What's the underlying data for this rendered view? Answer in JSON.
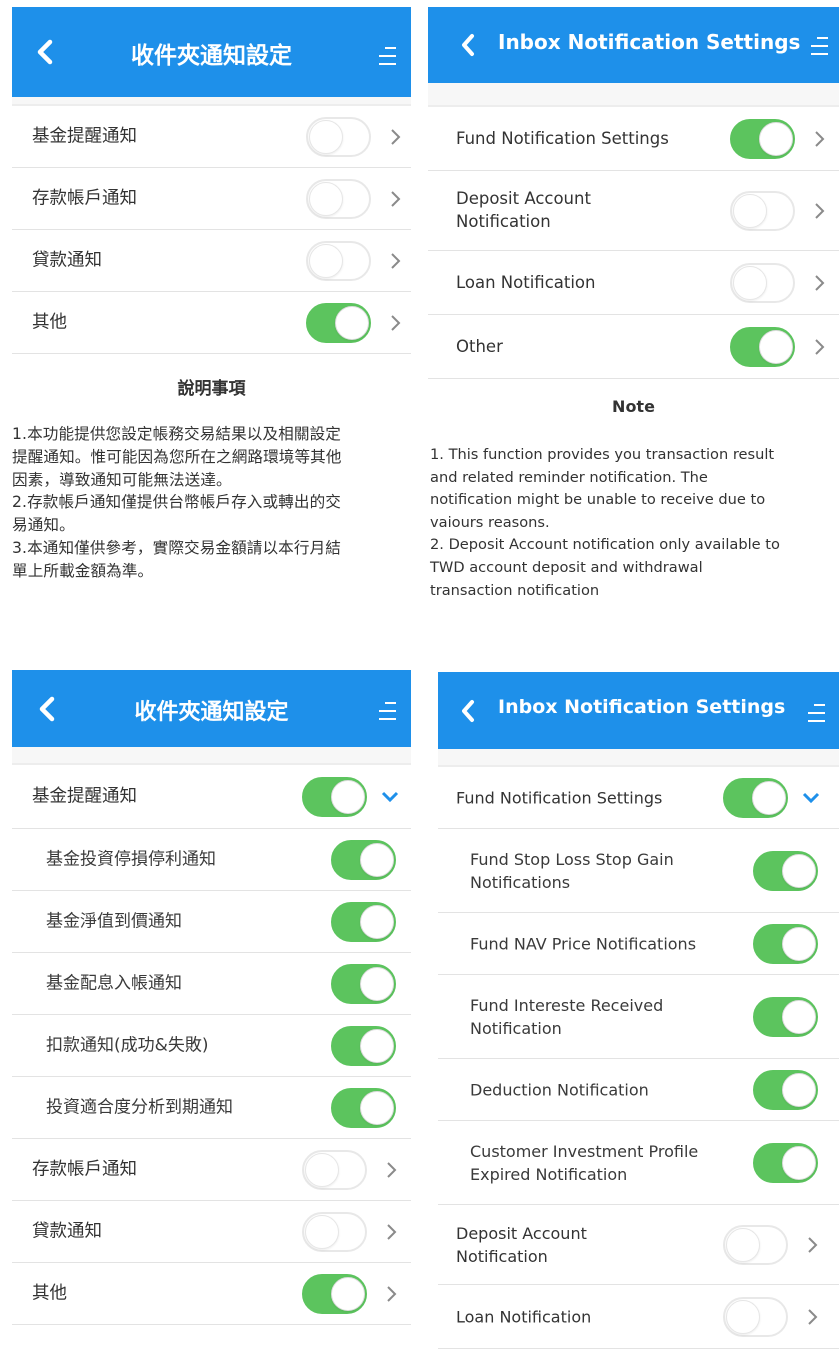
{
  "zh_screen": {
    "title": "收件夾通知設定",
    "items": [
      {
        "label": "基金提醒通知",
        "on": false
      },
      {
        "label": "存款帳戶通知",
        "on": false
      },
      {
        "label": "貸款通知",
        "on": false
      },
      {
        "label": "其他",
        "on": true
      }
    ],
    "note_title": "說明事項",
    "note_lines": [
      "1.本功能提供您設定帳務交易結果以及相關設定",
      "提醒通知。惟可能因為您所在之網路環境等其他",
      "因素，導致通知可能無法送達。",
      "2.存款帳戶通知僅提供台幣帳戶存入或轉出的交",
      "易通知。",
      "3.本通知僅供參考，實際交易金額請以本行月結",
      "單上所載金額為準。"
    ]
  },
  "en_screen": {
    "title": "Inbox Notification Settings",
    "items": [
      {
        "label": "Fund Notification Settings",
        "on": true
      },
      {
        "label": "Deposit Account\nNotification",
        "on": false
      },
      {
        "label": "Loan Notification",
        "on": false
      },
      {
        "label": "Other",
        "on": true
      }
    ],
    "note_title": "Note",
    "note_lines": [
      "1. This function provides you transaction result",
      "and related reminder notification. The",
      "notification might be unable to receive due to",
      "vaiours reasons.",
      "2. Deposit Account notification only available to",
      "TWD account deposit and withdrawal",
      "transaction notification"
    ]
  },
  "zh_expanded": {
    "title": "收件夾通知設定",
    "fund": {
      "label": "基金提醒通知",
      "on": true
    },
    "sub_items": [
      {
        "label": "基金投資停損停利通知",
        "on": true
      },
      {
        "label": "基金淨值到價通知",
        "on": true
      },
      {
        "label": "基金配息入帳通知",
        "on": true
      },
      {
        "label": "扣款通知(成功&失敗)",
        "on": true
      },
      {
        "label": "投資適合度分析到期通知",
        "on": true
      }
    ],
    "items": [
      {
        "label": "存款帳戶通知",
        "on": false
      },
      {
        "label": "貸款通知",
        "on": false
      },
      {
        "label": "其他",
        "on": true
      }
    ]
  },
  "en_expanded": {
    "title": "Inbox Notification Settings",
    "fund": {
      "label": "Fund Notification Settings",
      "on": true
    },
    "sub_items": [
      {
        "label": "Fund Stop Loss Stop Gain\nNotifications",
        "on": true
      },
      {
        "label": "Fund NAV Price Notifications",
        "on": true
      },
      {
        "label": "Fund Intereste Received\nNotification",
        "on": true
      },
      {
        "label": "Deduction Notification",
        "on": true
      },
      {
        "label": "Customer Investment Profile\nExpired Notification",
        "on": true
      }
    ],
    "items": [
      {
        "label": "Deposit Account\nNotification",
        "on": false
      },
      {
        "label": "Loan Notification",
        "on": false
      }
    ]
  },
  "colors": {
    "header": "#1e90ea",
    "toggle_on": "#5cc45e",
    "chevron_down": "#1e90ea",
    "chevron_right": "#8a8a8a"
  },
  "icons": {
    "back": "back-arrow-icon",
    "menu": "menu-icon",
    "expand": "chevron-down-icon",
    "navigate": "chevron-right-icon"
  }
}
